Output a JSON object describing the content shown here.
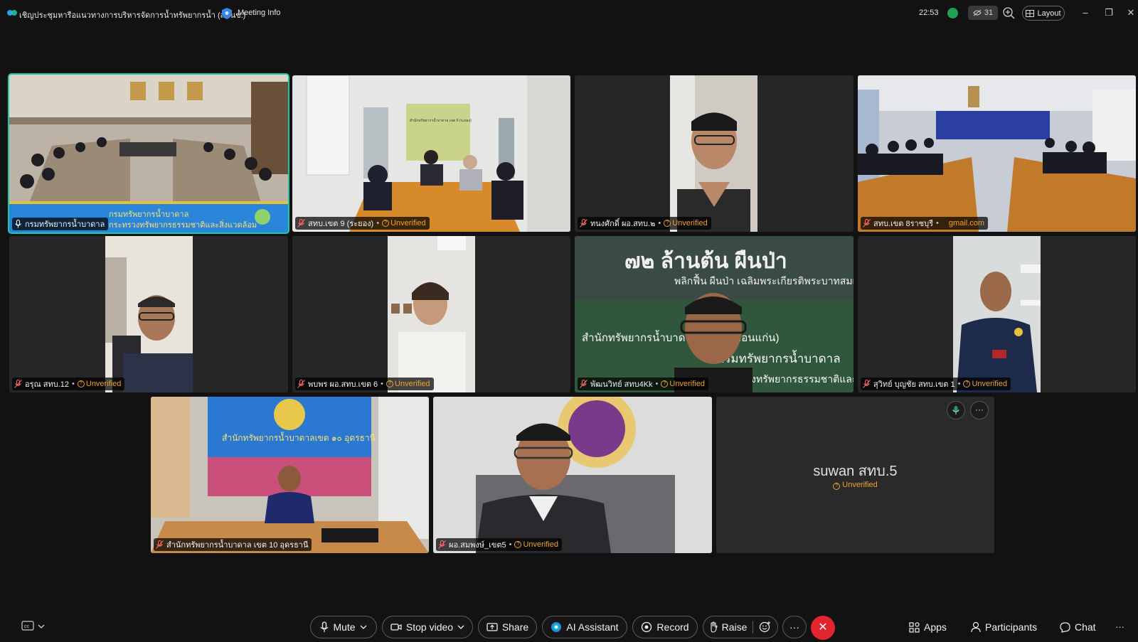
{
  "titlebar": {
    "meeting_title": "เชิญประชุมหารือแนวทางการบริหารจัดการน้ำทรัพยากรน้ำ (สทนช.)",
    "meeting_info": "Meeting Info",
    "clock": "22:53",
    "hidden_count": "31",
    "layout_label": "Layout"
  },
  "tiles": [
    {
      "name": "กรมทรัพยากรน้ำบาดาล",
      "banner_line1": "กรมทรัพยากรน้ำบาดาล",
      "banner_line2": "กระทรวงทรัพยากรธรรมชาติและสิ่งแวดล้อม"
    },
    {
      "name": "สทบ.เขต 9 (ระยอง)",
      "status": "Unverified",
      "poster_text": "สำนักทรัพยากรน้ำบาดาล เขต 9 (ระยอง)"
    },
    {
      "name": "ทนงศักดิ์ ผอ.สทบ.๒",
      "status": "Unverified"
    },
    {
      "name": "สทบ.เขต 8ราชบุรี",
      "email": "gmail.com"
    },
    {
      "name": "อรุณ สทบ.12",
      "status": "Unverified"
    },
    {
      "name": "พบพร ผอ.สทบ.เขต 6",
      "status": "Unverified"
    },
    {
      "name": "พัฒนวิทย์ สทบ4Kk",
      "status": "Unverified",
      "bg_line1": "๗๒ ล้านต้น ผืนป่า",
      "bg_line2": "พลิกฟื้น ผืนป่า เฉลิมพระเกียรติพระบาทสมเด็จพระเจ้าอยู่หัว",
      "bg_line3": "สำนักทรัพยากรน้ำบาดาล เขต 4 (ขอนแก่น)",
      "bg_line4": "กรมทรัพยากรน้ำบาดาล",
      "bg_line5": "กระทรวงทรัพยากรธรรมชาติและสิ่งแวดล้อม"
    },
    {
      "name": "สุวิทย์ บุญชัย สทบ.เขต 1",
      "status": "Unverified"
    },
    {
      "name": "สำนักทรัพยากรน้ำบาดาล เขต 10 อุดรธานี",
      "backdrop_text": "สำนักทรัพยากรน้ำบาดาลเขต ๑๐ อุดรธานี"
    },
    {
      "name": "ผอ.สมพงษ์_เขต5",
      "status": "Unverified"
    },
    {
      "name": "suwan สทบ.5",
      "status": "Unverified"
    }
  ],
  "controls": {
    "mute": "Mute",
    "stop_video": "Stop video",
    "share": "Share",
    "ai_assistant": "AI Assistant",
    "record": "Record",
    "raise": "Raise",
    "more": "···",
    "end": "✕",
    "apps": "Apps",
    "participants": "Participants",
    "chat": "Chat"
  },
  "colors": {
    "background": "#121212",
    "tile": "#262626",
    "active_border": "#1cc8a8",
    "unverified": "#f0a030",
    "end_call": "#e2242f"
  }
}
